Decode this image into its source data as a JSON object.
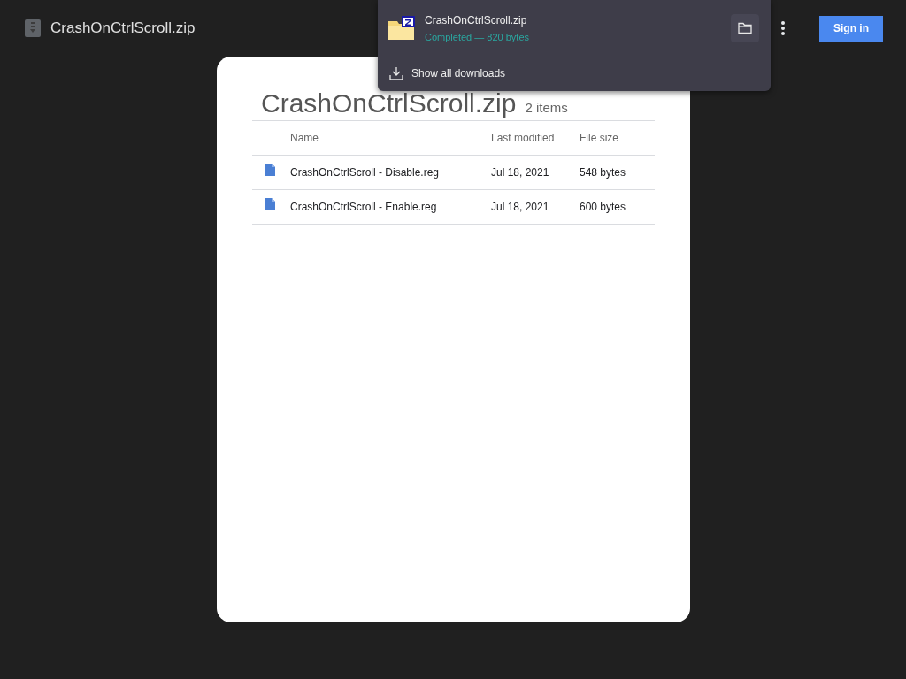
{
  "header": {
    "title": "CrashOnCtrlScroll.zip",
    "sign_in": "Sign in"
  },
  "archive": {
    "title": "CrashOnCtrlScroll.zip",
    "count": "2 items",
    "columns": [
      "Name",
      "Last modified",
      "File size"
    ],
    "rows": [
      {
        "name": "CrashOnCtrlScroll - Disable.reg",
        "modified": "Jul 18, 2021",
        "size": "548 bytes"
      },
      {
        "name": "CrashOnCtrlScroll - Enable.reg",
        "modified": "Jul 18, 2021",
        "size": "600 bytes"
      }
    ]
  },
  "downloads_popup": {
    "file": "CrashOnCtrlScroll.zip",
    "status": "Completed — 820 bytes",
    "show_all": "Show all downloads"
  }
}
